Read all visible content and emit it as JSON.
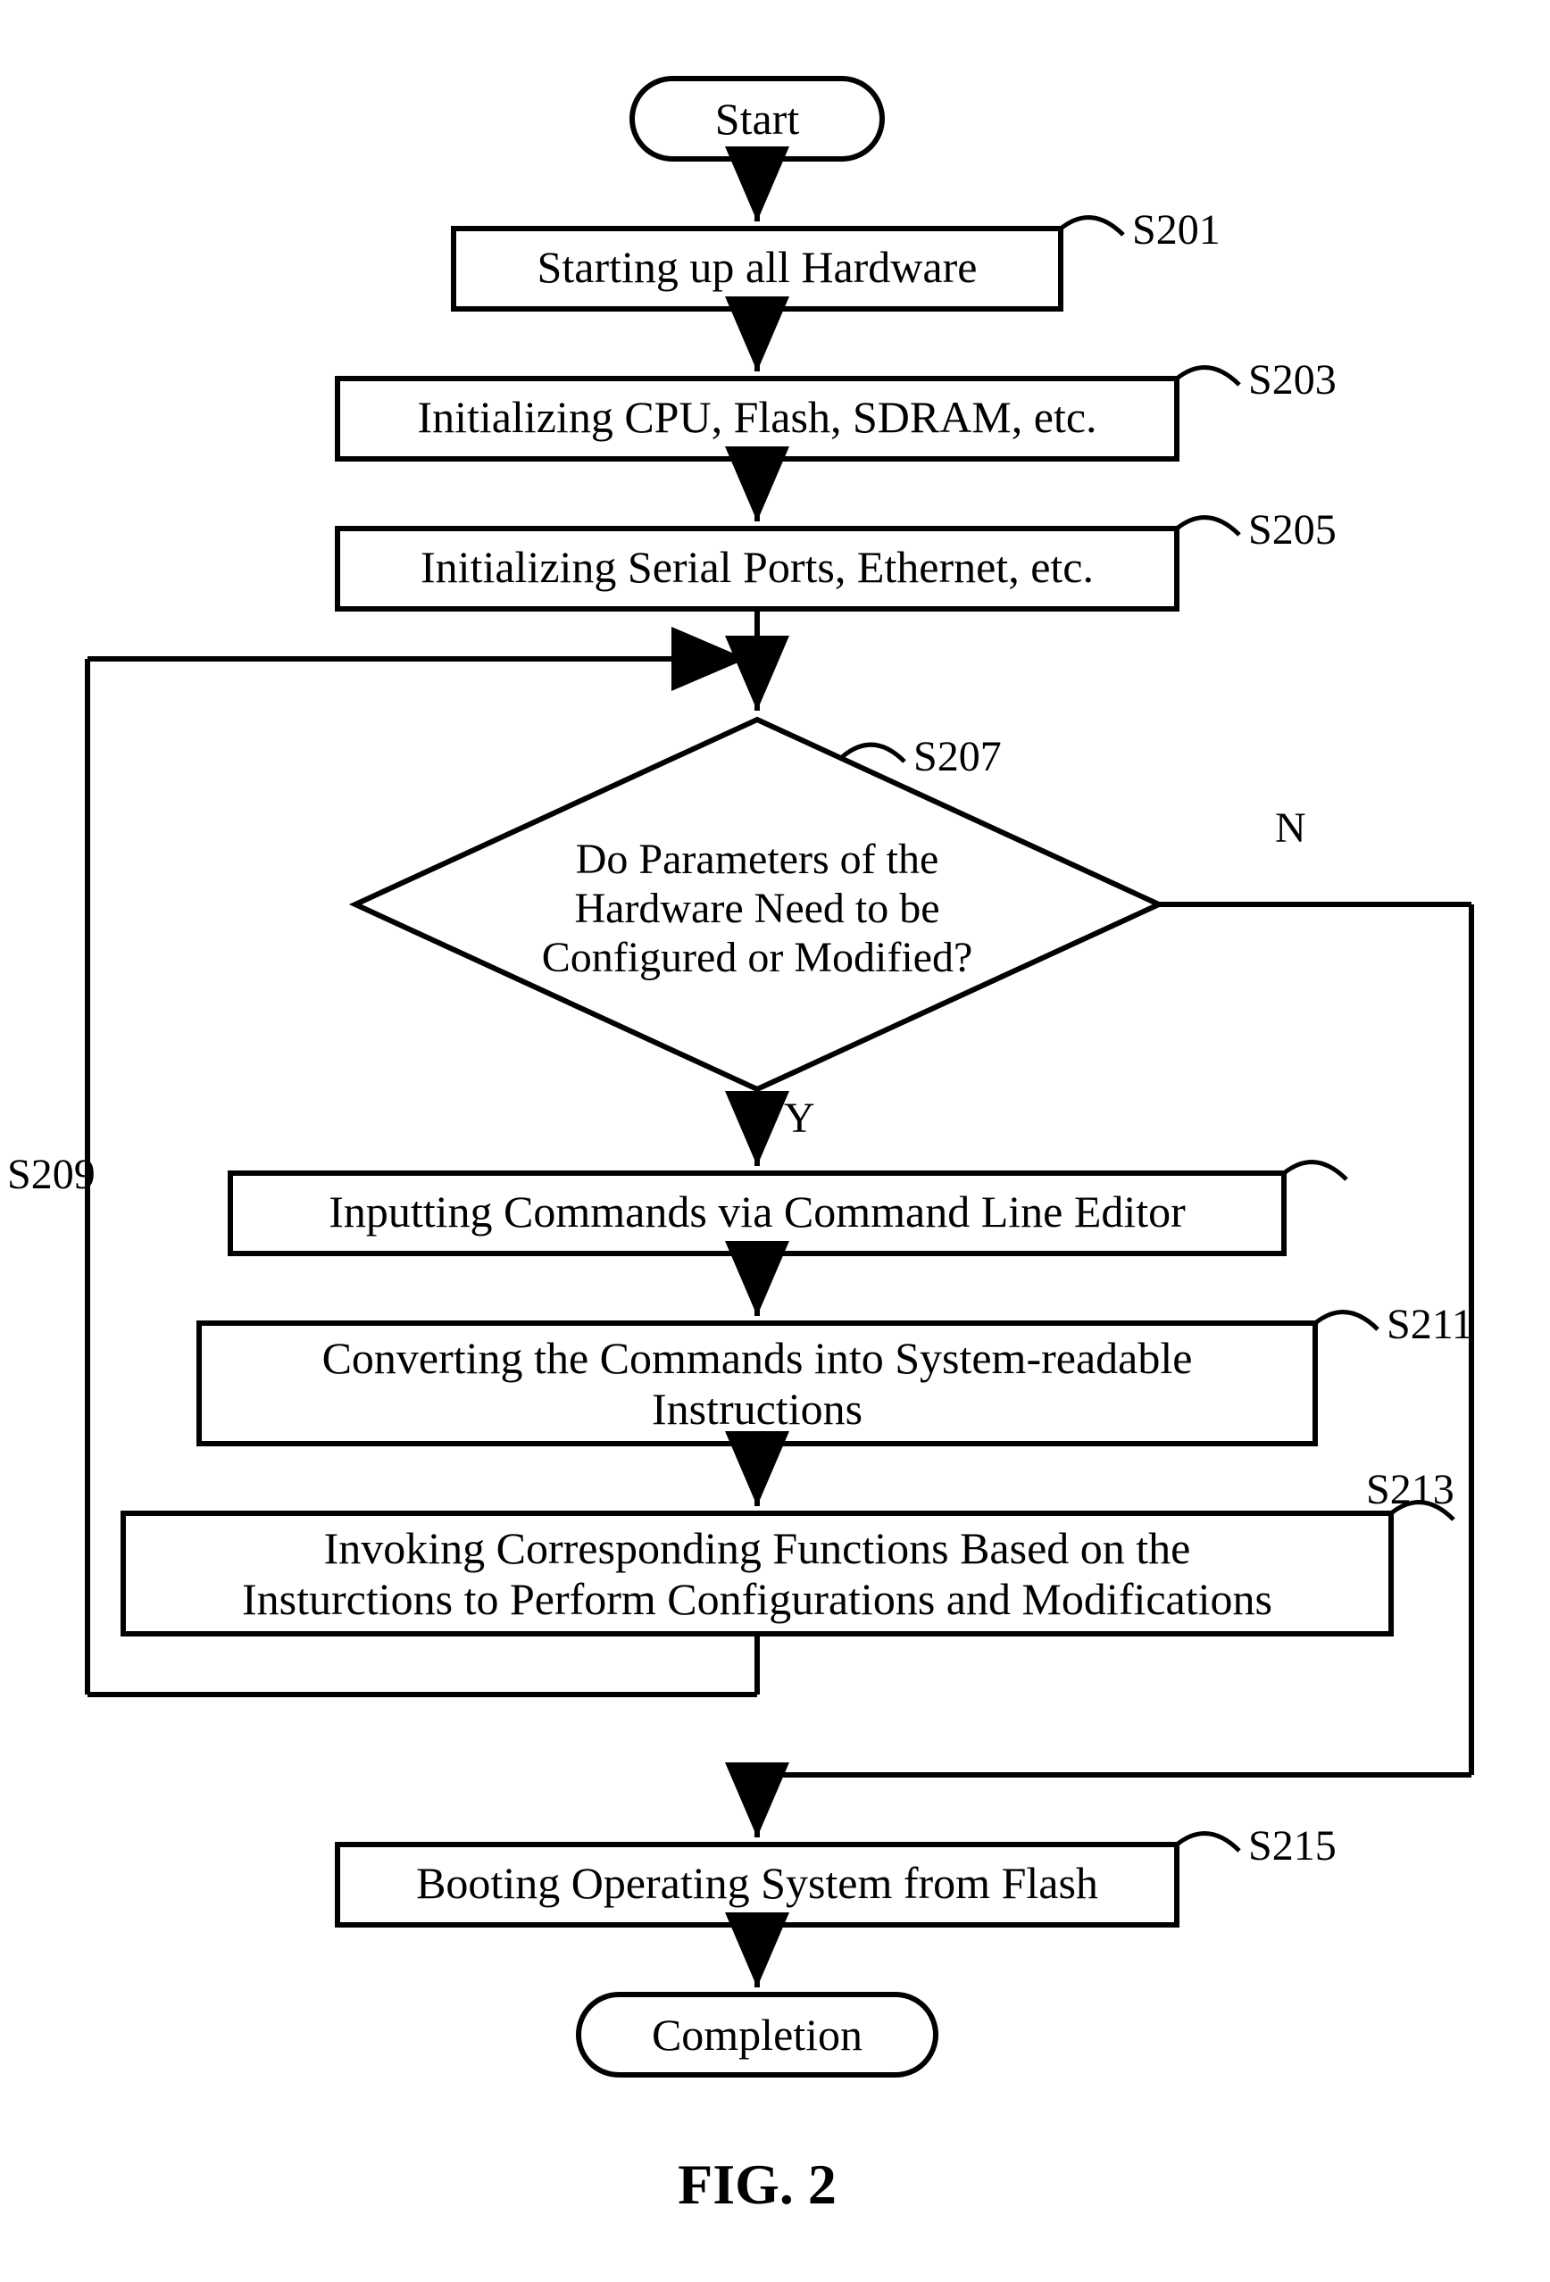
{
  "chart_data": {
    "type": "flowchart",
    "title": "FIG. 2",
    "nodes": [
      {
        "id": "start",
        "shape": "terminator",
        "label": "Start"
      },
      {
        "id": "s201",
        "shape": "process",
        "label": "Starting up all Hardware",
        "ref": "S201"
      },
      {
        "id": "s203",
        "shape": "process",
        "label": "Initializing CPU, Flash, SDRAM, etc.",
        "ref": "S203"
      },
      {
        "id": "s205",
        "shape": "process",
        "label": "Initializing Serial Ports, Ethernet, etc.",
        "ref": "S205"
      },
      {
        "id": "s207",
        "shape": "decision",
        "label": "Do Parameters of the Hardware Need to be Configured or Modified?",
        "ref": "S207"
      },
      {
        "id": "s209",
        "shape": "process",
        "label": "Inputting Commands via Command Line Editor",
        "ref": "S209"
      },
      {
        "id": "s211",
        "shape": "process",
        "label": "Converting the Commands into System-readable Instructions",
        "ref": "S211"
      },
      {
        "id": "s213",
        "shape": "process",
        "label": "Invoking Corresponding Functions Based on the Insturctions to Perform Configurations and Modifications",
        "ref": "S213"
      },
      {
        "id": "s215",
        "shape": "process",
        "label": "Booting Operating System from Flash",
        "ref": "S215"
      },
      {
        "id": "completion",
        "shape": "terminator",
        "label": "Completion"
      }
    ],
    "edges": [
      {
        "from": "start",
        "to": "s201"
      },
      {
        "from": "s201",
        "to": "s203"
      },
      {
        "from": "s203",
        "to": "s205"
      },
      {
        "from": "s205",
        "to": "s207"
      },
      {
        "from": "s207",
        "to": "s209",
        "label": "Y"
      },
      {
        "from": "s207",
        "to": "s215",
        "label": "N"
      },
      {
        "from": "s209",
        "to": "s211"
      },
      {
        "from": "s211",
        "to": "s213"
      },
      {
        "from": "s213",
        "to": "s207",
        "loopback": true
      },
      {
        "from": "s215",
        "to": "completion"
      }
    ]
  },
  "labels": {
    "start": "Start",
    "completion": "Completion",
    "fig": "FIG. 2",
    "yes": "Y",
    "no": "N",
    "s201_ref": "S201",
    "s201_text": "Starting up all Hardware",
    "s203_ref": "S203",
    "s203_text": "Initializing CPU, Flash, SDRAM, etc.",
    "s205_ref": "S205",
    "s205_text": "Initializing Serial Ports, Ethernet, etc.",
    "s207_ref": "S207",
    "s207_line1": "Do Parameters of the",
    "s207_line2": "Hardware Need to be",
    "s207_line3": "Configured or Modified?",
    "s209_ref": "S209",
    "s209_text": "Inputting Commands via Command Line Editor",
    "s211_ref": "S211",
    "s211_line1": "Converting the Commands into System-readable",
    "s211_line2": "Instructions",
    "s213_ref": "S213",
    "s213_line1": "Invoking Corresponding Functions Based on the",
    "s213_line2": "Insturctions to Perform Configurations and Modifications",
    "s215_ref": "S215",
    "s215_text": "Booting Operating System from Flash"
  }
}
